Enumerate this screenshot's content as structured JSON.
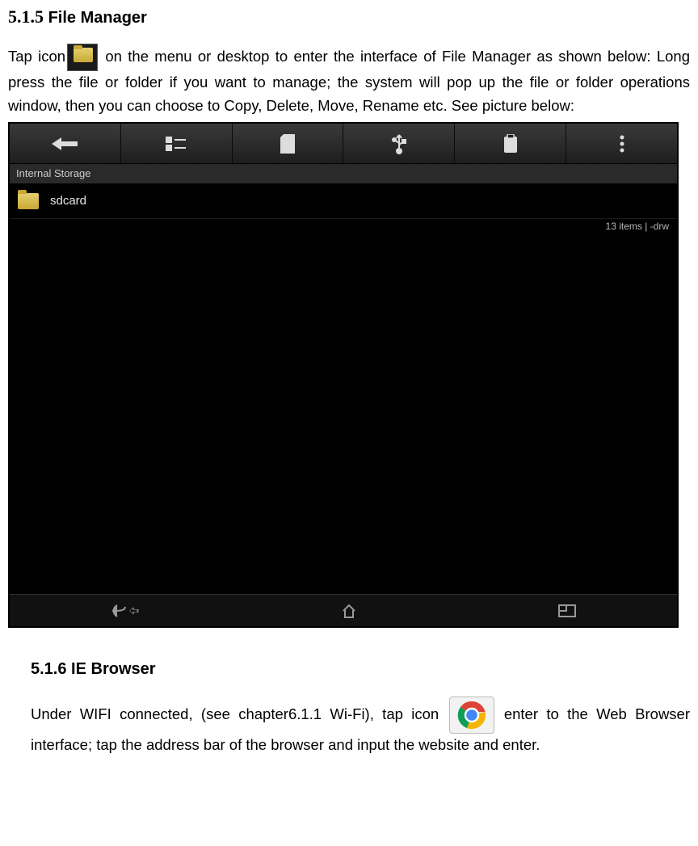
{
  "section1": {
    "number": "5.1.5",
    "title": "File Manager",
    "text_before_icon": "Tap icon",
    "text_after_icon": " on the menu or desktop to enter the interface of File Manager as shown below: Long press the file or folder if you want to   manage; the system will pop up the file or folder operations window, then you can choose to Copy, Delete, Move, Rename etc. See picture below:"
  },
  "file_manager": {
    "storage_label": "Internal Storage",
    "folder_name": "sdcard",
    "meta": "13 items | -drw"
  },
  "section2": {
    "number": "5.1.6",
    "title": "IE Browser",
    "text_before_icon": "Under WIFI connected, (see chapter6.1.1 Wi-Fi), tap icon ",
    "text_after_icon": " enter to the Web Browser interface; tap the address bar of the browser and input the website and enter."
  }
}
